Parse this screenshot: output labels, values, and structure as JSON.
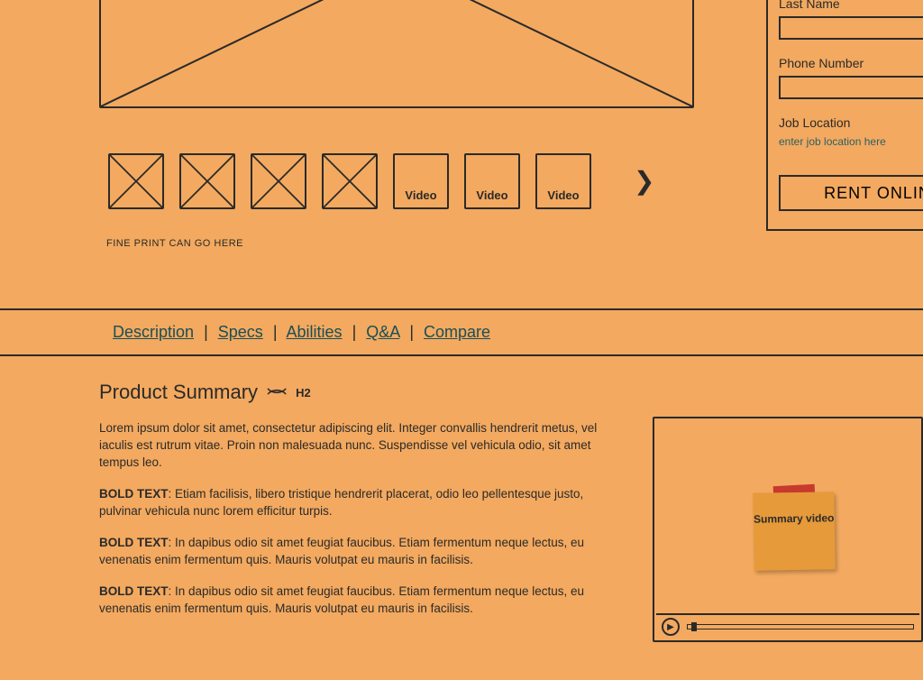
{
  "gallery": {
    "thumbs": [
      {
        "kind": "image",
        "label": ""
      },
      {
        "kind": "image",
        "label": ""
      },
      {
        "kind": "image",
        "label": ""
      },
      {
        "kind": "image",
        "label": ""
      },
      {
        "kind": "video",
        "label": "Video"
      },
      {
        "kind": "video",
        "label": "Video"
      },
      {
        "kind": "video",
        "label": "Video"
      }
    ],
    "fine_print": "FINE PRINT CAN GO HERE"
  },
  "form": {
    "last_name_label": "Last Name",
    "phone_label": "Phone Number",
    "job_location_label": "Job Location",
    "job_location_placeholder": "enter job location here",
    "submit_label": "RENT ONLINE"
  },
  "tabs": {
    "items": [
      "Description",
      "Specs",
      "Abilities",
      "Q&A",
      "Compare"
    ]
  },
  "summary": {
    "heading": "Product Summary",
    "heading_level": "H2",
    "intro": "Lorem ipsum dolor sit amet, consectetur adipiscing elit. Integer convallis hendrerit metus, vel iaculis est rutrum vitae. Proin non malesuada nunc. Suspendisse vel vehicula odio, sit amet tempus leo.",
    "bullets": [
      {
        "lead": "BOLD TEXT",
        "body": ": Etiam facilisis, libero tristique hendrerit placerat, odio leo pellentesque justo, pulvinar vehicula nunc lorem efficitur turpis."
      },
      {
        "lead": "BOLD TEXT",
        "body": ": In dapibus odio sit amet feugiat faucibus. Etiam fermentum neque lectus, eu venenatis enim fermentum quis. Mauris volutpat eu mauris in facilisis."
      },
      {
        "lead": "BOLD TEXT",
        "body": ": In dapibus odio sit amet feugiat faucibus. Etiam fermentum neque lectus, eu venenatis enim fermentum quis. Mauris volutpat eu mauris in facilisis."
      }
    ],
    "video_sticky_label": "Summary video"
  }
}
